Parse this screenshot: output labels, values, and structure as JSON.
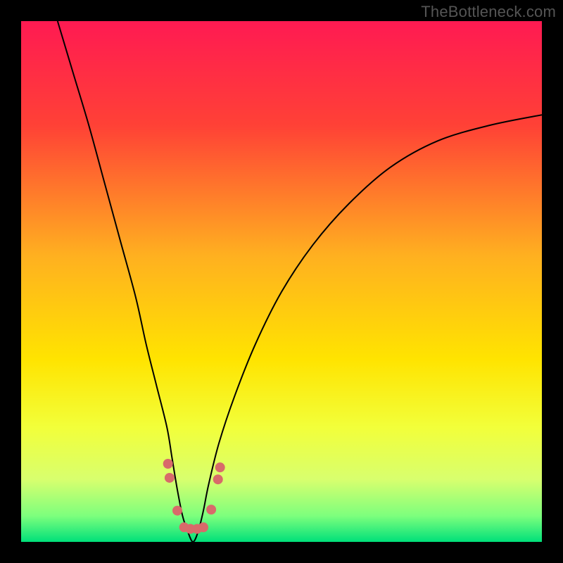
{
  "watermark": "TheBottleneck.com",
  "chart_data": {
    "type": "line",
    "title": "",
    "xlabel": "",
    "ylabel": "",
    "xlim": [
      0,
      100
    ],
    "ylim": [
      0,
      100
    ],
    "grid": false,
    "legend": false,
    "background": {
      "type": "vertical-gradient",
      "description": "bottleneck heat gradient red→orange→yellow→green top→bottom",
      "stops": [
        {
          "pos": 0.0,
          "color": "#ff1a52"
        },
        {
          "pos": 0.2,
          "color": "#ff4136"
        },
        {
          "pos": 0.45,
          "color": "#ffb020"
        },
        {
          "pos": 0.65,
          "color": "#ffe400"
        },
        {
          "pos": 0.78,
          "color": "#f2ff3a"
        },
        {
          "pos": 0.88,
          "color": "#d8ff6e"
        },
        {
          "pos": 0.95,
          "color": "#7dff7d"
        },
        {
          "pos": 1.0,
          "color": "#00e07a"
        }
      ]
    },
    "series": [
      {
        "name": "bottleneck-curve",
        "color": "#000000",
        "x": [
          7,
          10,
          13,
          16,
          19,
          22,
          24,
          26,
          28,
          29,
          30,
          31,
          32,
          33,
          34,
          35,
          36,
          38,
          41,
          45,
          50,
          56,
          63,
          71,
          80,
          90,
          100
        ],
        "values": [
          100,
          90,
          80,
          69,
          58,
          47,
          38,
          30,
          22,
          16,
          10,
          5,
          2,
          0,
          2,
          6,
          11,
          19,
          28,
          38,
          48,
          57,
          65,
          72,
          77,
          80,
          82
        ]
      }
    ],
    "markers": {
      "name": "highlight-points",
      "color": "#d86a6a",
      "radius": 7,
      "points": [
        {
          "x": 28.2,
          "y": 15.0
        },
        {
          "x": 28.5,
          "y": 12.3
        },
        {
          "x": 30.0,
          "y": 6.0
        },
        {
          "x": 31.3,
          "y": 2.8
        },
        {
          "x": 32.5,
          "y": 2.5
        },
        {
          "x": 33.8,
          "y": 2.5
        },
        {
          "x": 35.0,
          "y": 2.8
        },
        {
          "x": 36.5,
          "y": 6.2
        },
        {
          "x": 37.8,
          "y": 12.0
        },
        {
          "x": 38.2,
          "y": 14.3
        }
      ]
    }
  }
}
